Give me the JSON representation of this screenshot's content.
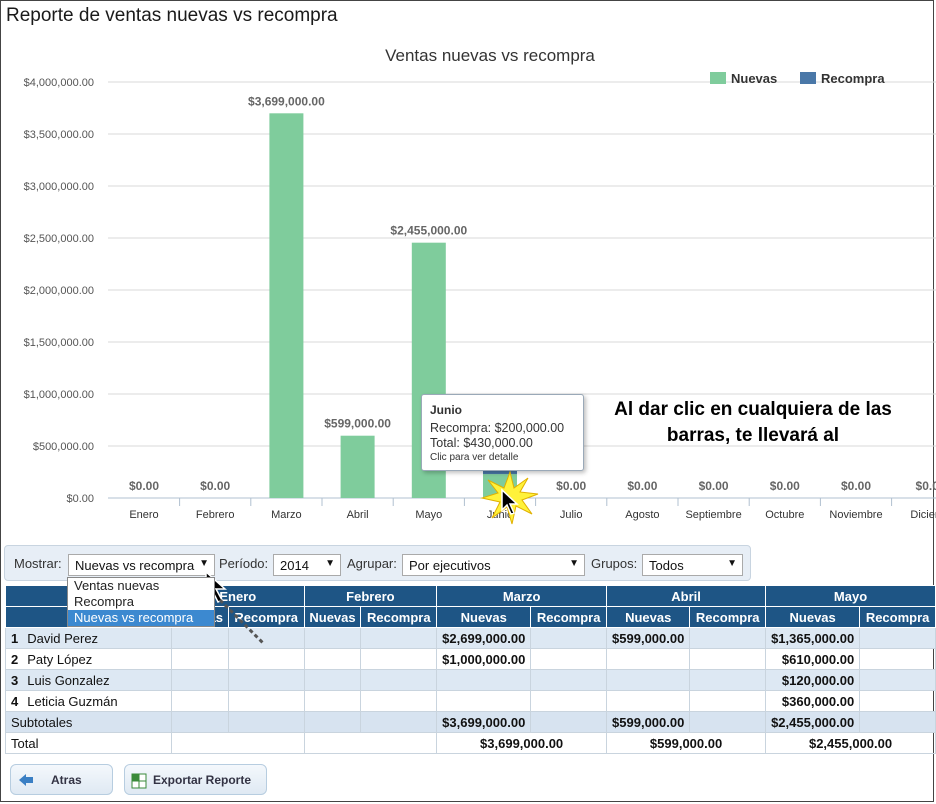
{
  "page": {
    "title": "Reporte de ventas nuevas vs recompra"
  },
  "chart_data": {
    "type": "bar",
    "title": "Ventas nuevas vs recompra",
    "categories": [
      "Enero",
      "Febrero",
      "Marzo",
      "Abril",
      "Mayo",
      "Junio",
      "Julio",
      "Agosto",
      "Septiembre",
      "Octubre",
      "Noviembre",
      "Diciem"
    ],
    "series": [
      {
        "name": "Nuevas",
        "color": "#7fcc9c",
        "values": [
          0,
          0,
          3699000,
          599000,
          2455000,
          230000,
          0,
          0,
          0,
          0,
          0,
          0
        ]
      },
      {
        "name": "Recompra",
        "color": "#4a78a8",
        "values": [
          0,
          0,
          0,
          0,
          0,
          200000,
          0,
          0,
          0,
          0,
          0,
          0
        ]
      }
    ],
    "data_labels": [
      "$0.00",
      "$0.00",
      "$3,699,000.00",
      "$599,000.00",
      "$2,455,000.00",
      "",
      "$0.00",
      "$0.00",
      "$0.00",
      "$0.00",
      "$0.00",
      "$0.0"
    ],
    "y_ticks": [
      "$0.00",
      "$500,000.00",
      "$1,000,000.00",
      "$1,500,000.00",
      "$2,000,000.00",
      "$2,500,000.00",
      "$3,000,000.00",
      "$3,500,000.00",
      "$4,000,000.00"
    ],
    "ylim": [
      0,
      4000000
    ],
    "legend_position": "top-right",
    "grid": true
  },
  "tooltip": {
    "title": "Junio",
    "line1": "Recompra: $200,000.00",
    "line2": "Total: $430,000.00",
    "hint": "Clic para ver detalle"
  },
  "annotation": {
    "text": "Al dar clic en cualquiera de las barras, te llevará al"
  },
  "filters": {
    "mostrar_label": "Mostrar:",
    "mostrar_value": "Nuevas vs recompra",
    "periodo_label": "Período:",
    "periodo_value": "2014",
    "agrupar_label": "Agrupar:",
    "agrupar_value": "Por ejecutivos",
    "grupos_label": "Grupos:",
    "grupos_value": "Todos"
  },
  "dropdown": {
    "options": [
      "Ventas nuevas",
      "Recompra",
      "Nuevas vs recompra"
    ]
  },
  "table": {
    "first_header": "E",
    "months": [
      "Enero",
      "Febrero",
      "Marzo",
      "Abril",
      "Mayo"
    ],
    "sub_nuevas": "Nuevas",
    "sub_recompra": "Recompra",
    "rows": [
      {
        "idx": "1",
        "name": "David Perez",
        "cells": [
          "",
          "",
          "",
          "",
          "$2,699,000.00",
          "",
          "$599,000.00",
          "",
          "$1,365,000.00",
          ""
        ]
      },
      {
        "idx": "2",
        "name": "Paty López",
        "cells": [
          "",
          "",
          "",
          "",
          "$1,000,000.00",
          "",
          "",
          "",
          "$610,000.00",
          ""
        ]
      },
      {
        "idx": "3",
        "name": "Luis Gonzalez",
        "cells": [
          "",
          "",
          "",
          "",
          "",
          "",
          "",
          "",
          "$120,000.00",
          ""
        ]
      },
      {
        "idx": "4",
        "name": "Leticia Guzmán",
        "cells": [
          "",
          "",
          "",
          "",
          "",
          "",
          "",
          "",
          "$360,000.00",
          ""
        ]
      }
    ],
    "subtotal_label": "Subtotales",
    "subtotals": [
      "",
      "",
      "",
      "",
      "$3,699,000.00",
      "",
      "$599,000.00",
      "",
      "$2,455,000.00",
      ""
    ],
    "total_label": "Total",
    "totals": [
      "",
      "",
      "$3,699,000.00",
      "$599,000.00",
      "$2,455,000.00"
    ]
  },
  "buttons": {
    "back": "Atras",
    "export": "Exportar Reporte"
  }
}
